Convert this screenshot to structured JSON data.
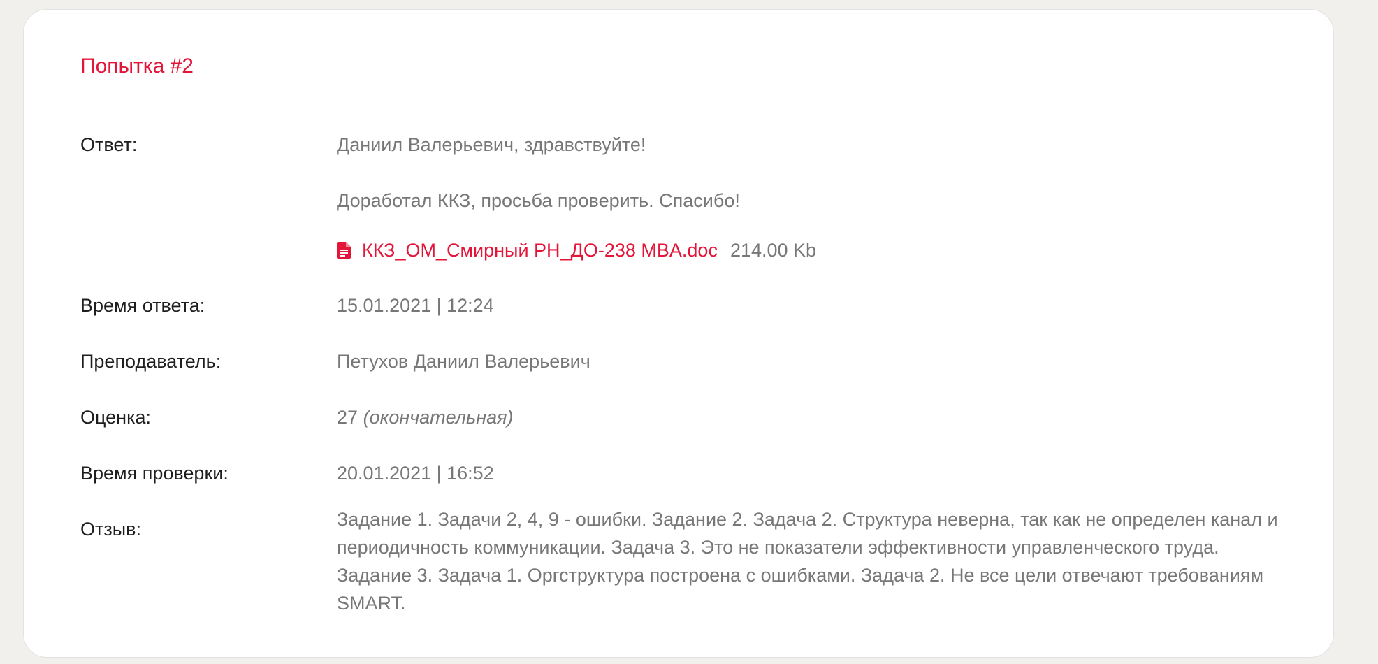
{
  "attempt": {
    "title": "Попытка #2"
  },
  "fields": {
    "answer_label": "Ответ:",
    "answer_greeting": "Даниил Валерьевич, здравствуйте!",
    "answer_text": "Доработал ККЗ, просьба проверить. Спасибо!",
    "attachment": {
      "icon": "document-icon",
      "filename": "ККЗ_ОМ_Смирный РН_ДО-238 MBA.doc",
      "size": "214.00 Kb"
    },
    "answer_time_label": "Время ответа:",
    "answer_time_value": "15.01.2021 | 12:24",
    "teacher_label": "Преподаватель:",
    "teacher_value": "Петухов Даниил Валерьевич",
    "grade_label": "Оценка:",
    "grade_value": "27",
    "grade_note": "(окончательная)",
    "check_time_label": "Время проверки:",
    "check_time_value": "20.01.2021 | 16:52",
    "feedback_label": "Отзыв:",
    "feedback_value": "Задание 1. Задачи 2, 4, 9 - ошибки. Задание 2. Задача 2. Структура неверна, так как не определен канал и периодичность коммуникации. Задача 3. Это не показатели эффективности управленческого труда. Задание 3. Задача 1. Оргструктура построена с ошибками. Задача 2. Не все цели отвечают требованиям SMART."
  },
  "colors": {
    "accent": "#e3163a",
    "label_text": "#1e1e1e",
    "value_text": "#777777",
    "page_background": "#f1f0ed"
  }
}
